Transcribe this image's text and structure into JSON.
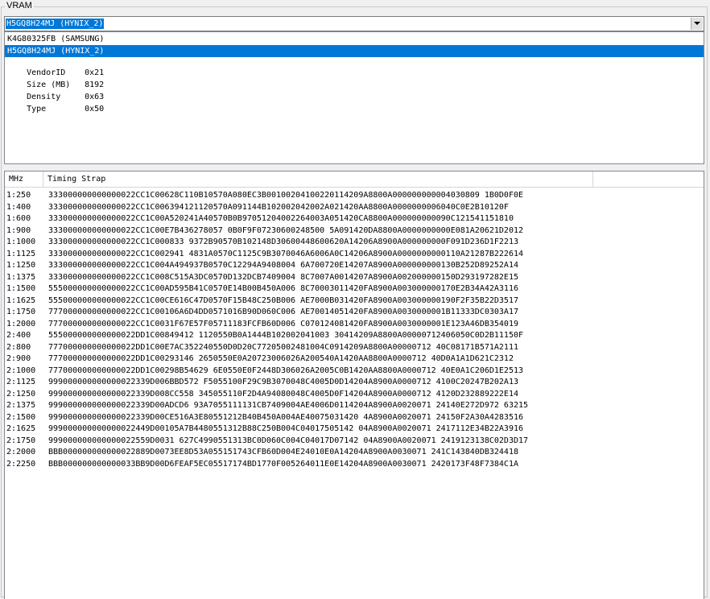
{
  "group": {
    "title": "VRAM"
  },
  "combo": {
    "selected": "H5GQ8H24MJ (HYNIX_2)"
  },
  "vram_list": {
    "items": [
      {
        "label": "K4G80325FB (SAMSUNG)",
        "selected": false
      },
      {
        "label": "H5GQ8H24MJ (HYNIX_2)",
        "selected": true
      }
    ],
    "properties": [
      {
        "key": "VendorID",
        "value": "0x21"
      },
      {
        "key": "Size (MB)",
        "value": "8192"
      },
      {
        "key": "Density",
        "value": "0x63"
      },
      {
        "key": "Type",
        "value": "0x50"
      }
    ]
  },
  "timing_table": {
    "headers": {
      "mhz": "MHz",
      "strap": "Timing Strap"
    },
    "rows": [
      {
        "mhz": "1:250",
        "strap": "333000000000000022CC1C00628C110B10570A080EC3B00100204100220114209A8800A000000000004030809 1B0D0F0E"
      },
      {
        "mhz": "1:400",
        "strap": "333000000000000022CC1C006394121120570A091144B102002042002A021420AA8800A0000000006040C0E2B10120F"
      },
      {
        "mhz": "1:600",
        "strap": "333000000000000022CC1C00A520241A40570B0B97051204002264003A051420CA8800A000000000090C121541151810"
      },
      {
        "mhz": "1:900",
        "strap": "333000000000000022CC1C00E7B436278057 0B0F9F07230600248500 5A091420DA8800A0000000000E081A20621D2012"
      },
      {
        "mhz": "1:1000",
        "strap": "333000000000000022CC1C000833 9372B90570B102148D30600448600620A14206A8900A000000000F091D236D1F2213"
      },
      {
        "mhz": "1:1125",
        "strap": "333000000000000022CC1C002941 4831A0570C1125C9B3070046A6006A0C14206A8900A0000000000110A21287B222614"
      },
      {
        "mhz": "1:1250",
        "strap": "333000000000000022CC1C004A494937B0570C12294A9408004 6A700720E14207A8900A000000000130B252D89252A14"
      },
      {
        "mhz": "1:1375",
        "strap": "333000000000000022CC1C008C515A3DC0570D132DCB7409004 8C7007A0014207A8900A002000000150D293197282E15"
      },
      {
        "mhz": "1:1500",
        "strap": "555000000000000022CC1C00AD595B41C0570E14B00B450A006 8C70003011420FA8900A003000000170E2B34A42A3116"
      },
      {
        "mhz": "1:1625",
        "strap": "555000000000000022CC1C00CE616C47D0570F15B48C250B006 AE7000B031420FA8900A003000000190F2F35B22D3517"
      },
      {
        "mhz": "1:1750",
        "strap": "777000000000000022CC1C00106A6D4DD0571016B90D060C006 AE70014051420FA8900A0030000001B11333DC0303A17"
      },
      {
        "mhz": "1:2000",
        "strap": "777000000000000022CC1C0031F67E57F05711183FCFB60D006 C070124081420FA8900A0030000001E123A46DB354019"
      },
      {
        "mhz": "2:400",
        "strap": "555000000000000022DD1C00849412 1120550B0A1444B102002041003 30414209A8800A00000712406050C0D2B11150F"
      },
      {
        "mhz": "2:800",
        "strap": "777000000000000022DD1C00E7AC352240550D0D20C77205002481004C0914209A8800A00000712 40C08171B571A2111"
      },
      {
        "mhz": "2:900",
        "strap": "777000000000000022DD1C00293146 2650550E0A20723006026A200540A1420AA8800A0000712 40D0A1A1D621C2312"
      },
      {
        "mhz": "2:1000",
        "strap": "777000000000000022DD1C00298B54629 6E0550E0F2448D306026A2005C0B1420AA8800A0000712 40E0A1C206D1E2513"
      },
      {
        "mhz": "2:1125",
        "strap": "999000000000000022339D006BBD572 F5055100F29C9B3070048C4005D0D14204A8900A0000712 4100C20247B202A13"
      },
      {
        "mhz": "2:1250",
        "strap": "999000000000000022339D008CC558 345055110F2D4A94080048C4005D0F14204A8900A0000712 4120D232889222E14"
      },
      {
        "mhz": "2:1375",
        "strap": "999000000000000022339D00ADCD6 93A7055111131CB7409004AE4006D0114204A8900A0020071 24140E272D972 63215"
      },
      {
        "mhz": "2:1500",
        "strap": "999000000000000022339D00CE516A3E80551212B40B450A004AE40075031420 4A8900A0020071 24150F2A30A4283516"
      },
      {
        "mhz": "2:1625",
        "strap": "999000000000000022449D00105A7B4480551312B88C250B004C04017505142 04A8900A0020071 2417112E34B22A3916"
      },
      {
        "mhz": "2:1750",
        "strap": "999000000000000022559D0031 627C4990551313BC0D060C004C04017D07142 04A8900A0020071 2419123138C02D3D17"
      },
      {
        "mhz": "2:2000",
        "strap": "BBB000000000000022889D0073EE8D53A055151743CFB60D004E24010E0A14204A8900A0030071 241C143840DB324418"
      },
      {
        "mhz": "2:2250",
        "strap": "BBB000000000000033BB9D00D6FEAF5EC05517174BD1770F005264011E0E14204A8900A0030071 2420173F48F7384C1A"
      }
    ]
  },
  "colors": {
    "selection": "#0078d7",
    "selection_text": "#ffffff",
    "window_bg": "#f0f0f0"
  },
  "icons": {
    "combo_button": "chevron-down-icon"
  }
}
